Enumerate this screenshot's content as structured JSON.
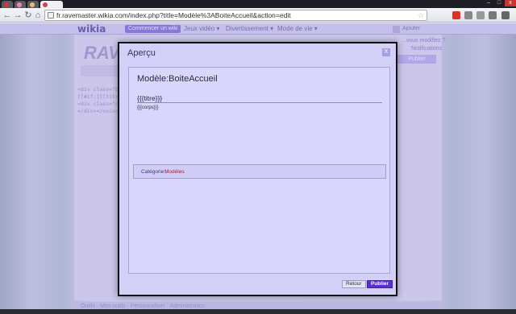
{
  "browser": {
    "url": "fr.ravemaster.wikia.com/index.php?title=Modèle%3ABoiteAccueil&action=edit",
    "window_controls": [
      "–",
      "□",
      "x"
    ]
  },
  "wikia": {
    "logo": "wikia",
    "start_wiki": "Commencer un wiki",
    "nav": [
      "Jeux vidéo ▾",
      "Divertissement ▾",
      "Mode de vie ▾"
    ],
    "username": "Ajouter",
    "side_links": [
      "...vous modifiez ?",
      "Notifications"
    ],
    "publish": "Publier",
    "editor_logo": "RAVE",
    "editor_source": "<div class=\"b...\n[[#if:[[[titre...\n<div class=\"co...\n</div></noinclude",
    "footer": "Outils   ·   Mes outils   ·   Personnaliser   ·   Administration"
  },
  "modal": {
    "title": "Aperçu",
    "close_label": "X",
    "page_heading": "Modèle:BoiteAccueil",
    "titre_placeholder": "{{{titre}}}",
    "corps_placeholder": "{{{corps}}}",
    "category_label": "Catégorie :",
    "category_value": "Modèles",
    "retour_button": "Retour",
    "publier_button": "Publier"
  },
  "colors": {
    "accent": "#5a2fd6",
    "category_link": "#b0182a",
    "modal_bg": "#d2d0f6"
  }
}
